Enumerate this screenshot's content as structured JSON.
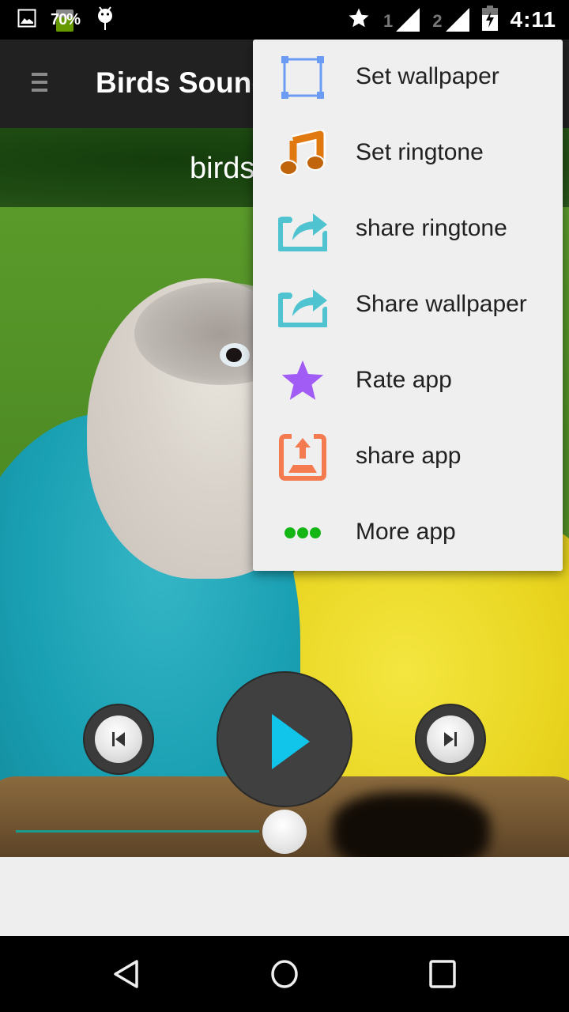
{
  "status_bar": {
    "battery_percent_badge": "70%",
    "sim1_label": "1",
    "sim2_label": "2",
    "time": "4:11",
    "icons": [
      "gallery-icon",
      "battery-70-icon",
      "android-debug-icon",
      "star-icon",
      "signal-sim1-icon",
      "signal-sim2-icon",
      "battery-charging-icon"
    ]
  },
  "app_bar": {
    "title": "Birds Sounds",
    "menu_icon": "hamburger-icon"
  },
  "sub_header": {
    "title": "birds sound"
  },
  "player": {
    "prev_icon": "skip-previous-icon",
    "play_icon": "play-icon",
    "next_icon": "skip-next-icon",
    "progress_percent": 50,
    "colors": {
      "play_accent": "#11c4ea",
      "seek_fill": "#1a9c8e"
    }
  },
  "overflow_menu": {
    "items": [
      {
        "label": "Set wallpaper",
        "icon": "crop-frame-icon",
        "color": "#6b9bf2"
      },
      {
        "label": "Set ringtone",
        "icon": "music-note-icon",
        "color": "#e07a10"
      },
      {
        "label": "share ringtone",
        "icon": "share-arrow-icon",
        "color": "#4fc3cf"
      },
      {
        "label": "Share wallpaper",
        "icon": "share-arrow-icon",
        "color": "#4fc3cf"
      },
      {
        "label": "Rate app",
        "icon": "star-icon",
        "color": "#a05cf5"
      },
      {
        "label": "share app",
        "icon": "upload-box-icon",
        "color": "#f47a50"
      },
      {
        "label": "More app",
        "icon": "more-dots-icon",
        "color": "#13b613"
      }
    ]
  },
  "nav_bar": {
    "back_icon": "back-icon",
    "home_icon": "home-icon",
    "recents_icon": "recents-icon"
  }
}
